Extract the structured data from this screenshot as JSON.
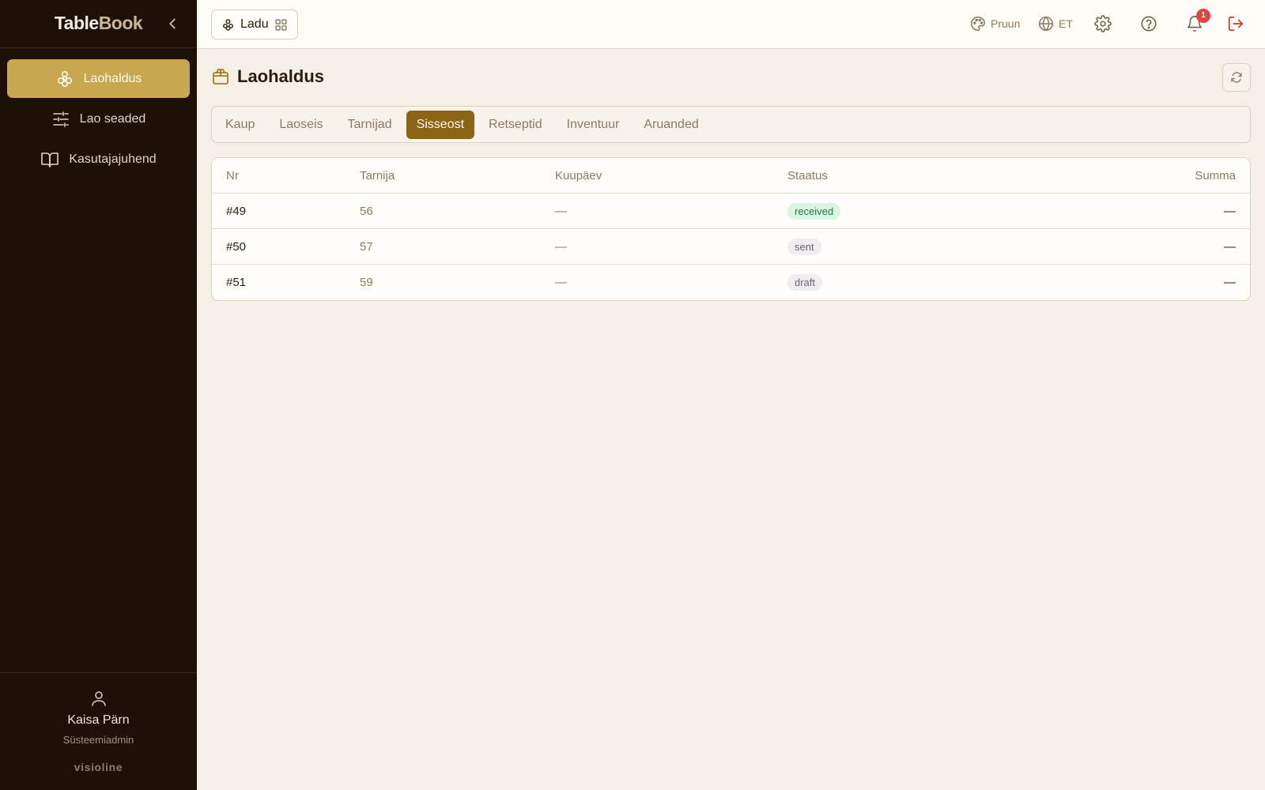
{
  "sidebar": {
    "brand_a": "Table",
    "brand_b": "Book",
    "items": [
      {
        "label": "Laohaldus",
        "icon": "boxes-icon",
        "active": true
      },
      {
        "label": "Lao seaded",
        "icon": "sliders-icon",
        "active": false
      },
      {
        "label": "Kasutajajuhend",
        "icon": "book-icon",
        "active": false
      }
    ],
    "user": {
      "name": "Kaisa Pärn",
      "role": "Süsteemiadmin"
    },
    "footer_brand": "visioline"
  },
  "topbar": {
    "module_label": "Ladu",
    "theme_label": "Pruun",
    "language_label": "ET",
    "notification_count": "1"
  },
  "page": {
    "title": "Laohaldus",
    "tabs": [
      {
        "label": "Kaup",
        "active": false
      },
      {
        "label": "Laoseis",
        "active": false
      },
      {
        "label": "Tarnijad",
        "active": false
      },
      {
        "label": "Sisseost",
        "active": true
      },
      {
        "label": "Retseptid",
        "active": false
      },
      {
        "label": "Inventuur",
        "active": false
      },
      {
        "label": "Aruanded",
        "active": false
      }
    ],
    "table": {
      "headers": [
        "Nr",
        "Tarnija",
        "Kuupäev",
        "Staatus",
        "Summa"
      ],
      "rows": [
        {
          "nr": "#49",
          "supplier": "56",
          "date": "—",
          "status": "received",
          "sum": "—"
        },
        {
          "nr": "#50",
          "supplier": "57",
          "date": "—",
          "status": "sent",
          "sum": "—"
        },
        {
          "nr": "#51",
          "supplier": "59",
          "date": "—",
          "status": "draft",
          "sum": "—"
        }
      ]
    }
  },
  "colors": {
    "sidebar_bg": "#1c1007",
    "active_nav": "#c9a650",
    "active_tab": "#8b6414",
    "page_bg": "#f5efe6",
    "badge": "#e24444",
    "logout": "#c0392b"
  }
}
